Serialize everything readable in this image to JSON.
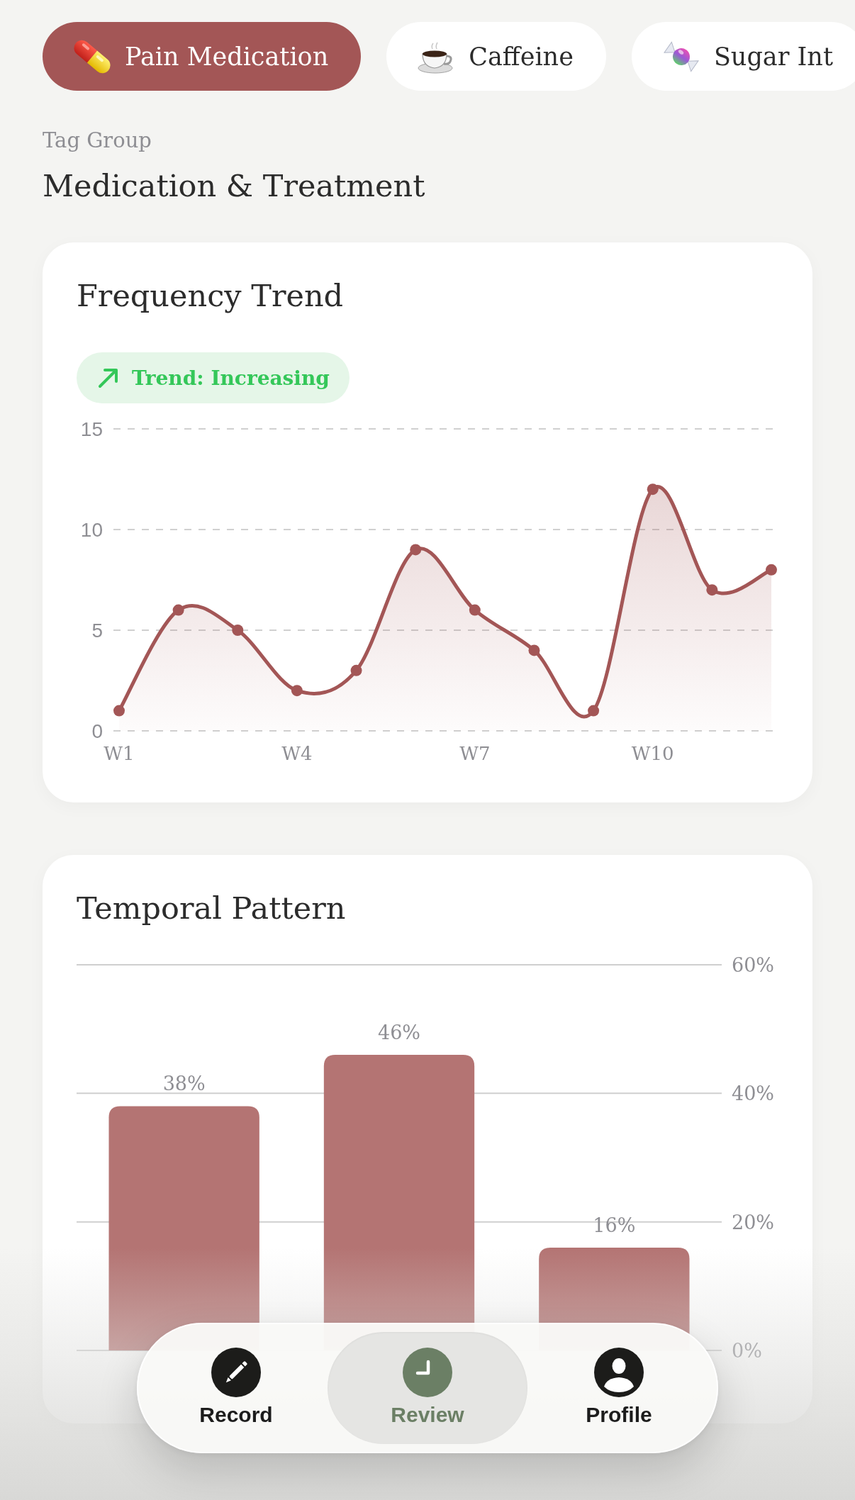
{
  "tags": [
    {
      "kind": "pill",
      "label": "Pain Medication",
      "selected": true
    },
    {
      "kind": "coffee",
      "label": "Caffeine",
      "selected": false
    },
    {
      "kind": "candy",
      "label": "Sugar Int",
      "selected": false
    }
  ],
  "tag_group": {
    "caption": "Tag Group",
    "title": "Medication & Treatment"
  },
  "frequency_trend": {
    "title": "Frequency Trend",
    "badge": {
      "kind": "increasing",
      "label": "Trend: Increasing"
    },
    "chart_data": {
      "type": "area",
      "categories": [
        "W1",
        null,
        null,
        "W4",
        null,
        null,
        "W7",
        null,
        null,
        "W10",
        null,
        null
      ],
      "ylim": [
        0,
        15
      ],
      "yticks": [
        0,
        5,
        10,
        15
      ],
      "series": [
        {
          "color": "#a35656",
          "values": [
            1,
            6,
            5,
            2,
            3,
            9,
            6,
            4,
            1,
            12,
            7,
            8
          ]
        }
      ]
    }
  },
  "temporal_pattern": {
    "title": "Temporal Pattern",
    "chart_data": {
      "type": "bar",
      "ylim": [
        0,
        60
      ],
      "yticks": [
        {
          "value": 0,
          "label": "0%"
        },
        {
          "value": 20,
          "label": "20%"
        },
        {
          "value": 40,
          "label": "40%"
        },
        {
          "value": 60,
          "label": "60%"
        }
      ],
      "series": [
        {
          "color": "#b47473",
          "values": [
            38,
            46,
            16
          ]
        }
      ],
      "value_labels": [
        "38%",
        "46%",
        "16%"
      ]
    }
  },
  "nav": [
    {
      "kind": "pencil",
      "label": "Record",
      "selected": false
    },
    {
      "kind": "clock",
      "label": "Review",
      "selected": true
    },
    {
      "kind": "person",
      "label": "Profile",
      "selected": false
    }
  ]
}
